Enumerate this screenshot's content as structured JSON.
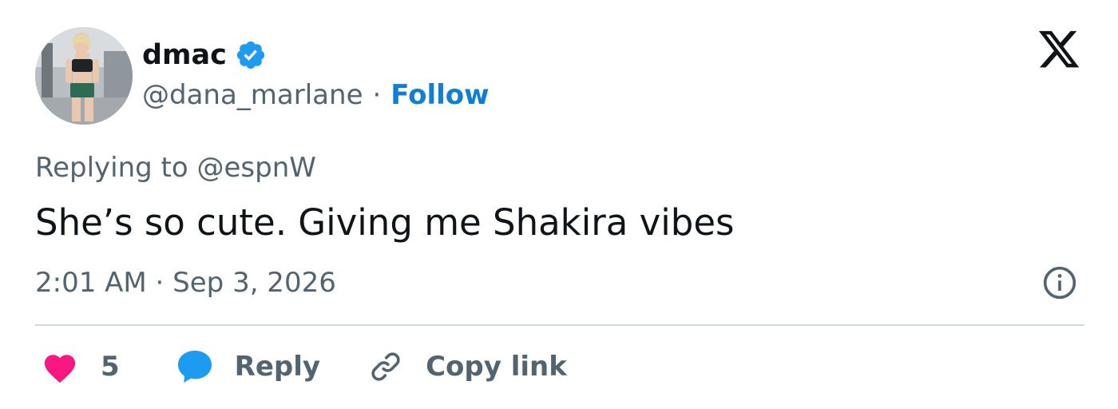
{
  "author": {
    "display_name": "dmac",
    "handle": "@dana_marlane",
    "separator": "·",
    "follow_label": "Follow",
    "verified": true
  },
  "tweet": {
    "replying_prefix": "Replying to",
    "replying_to": "@espnW",
    "text": "She’s so cute. Giving me Shakira vibes",
    "timestamp": "2:01 AM · Sep 3, 2026"
  },
  "actions": {
    "like_count": "5",
    "reply_label": "Reply",
    "copy_link_label": "Copy link"
  },
  "icons": {
    "brand": "x-logo-icon",
    "verified": "verified-badge-icon",
    "info": "info-icon",
    "like": "heart-icon",
    "reply": "speech-bubble-icon",
    "copy": "link-icon"
  },
  "colors": {
    "accent": "#1d9bf0",
    "follow": "#0f7fd6",
    "like": "#f91880",
    "secondary_text": "#536471",
    "primary_text": "#0f1419",
    "divider": "#cfd9de"
  }
}
